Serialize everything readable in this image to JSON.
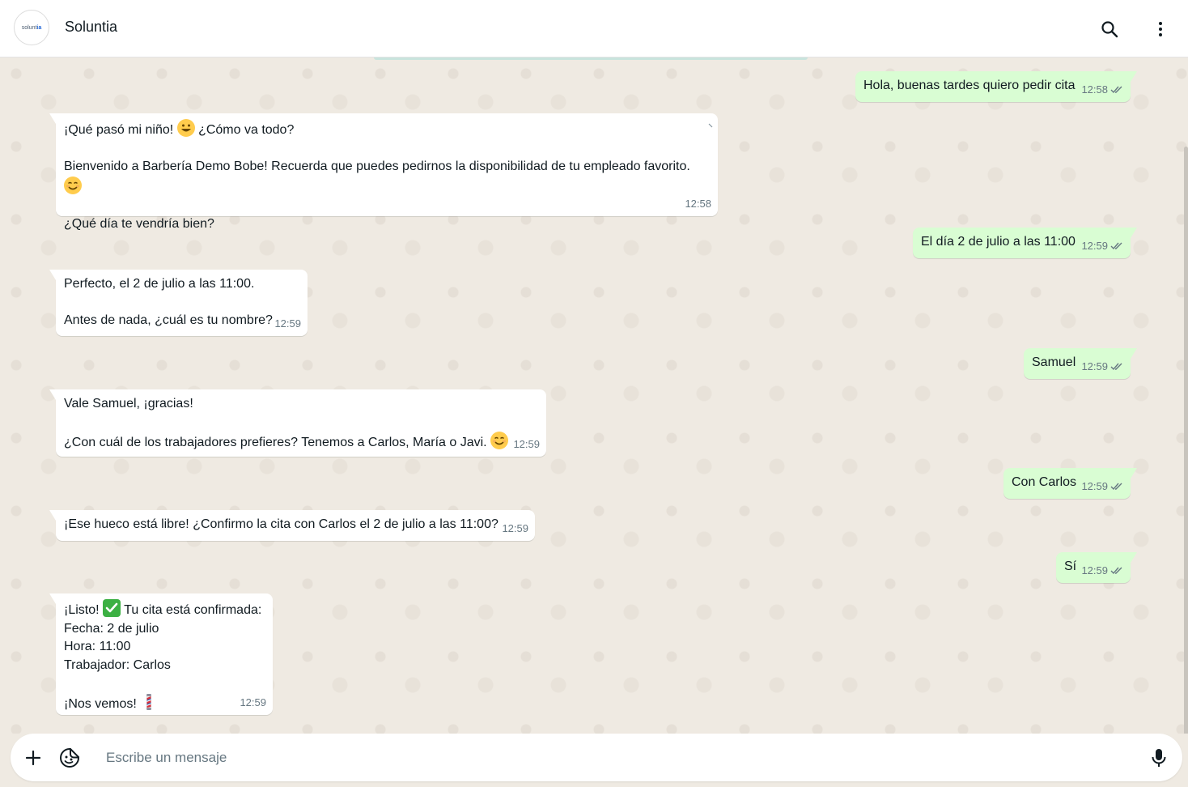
{
  "header": {
    "avatar_text_prefix": "solunt",
    "avatar_text_accent": "ia",
    "contact_name": "Soluntia"
  },
  "messages": [
    {
      "dir": "out",
      "text": "Hola, buenas tardes quiero pedir cita",
      "time": "12:58"
    },
    {
      "dir": "in",
      "line1": "¡Qué pasó mi niño! ",
      "line1b": " ¿Cómo va todo?",
      "line2": "Bienvenido a Barbería Demo Bobe! Recuerda que puedes pedirnos la disponibilidad de tu empleado favorito. ",
      "line3": "¿Qué día te vendría bien?",
      "time": "12:58"
    },
    {
      "dir": "out",
      "text": "El día 2 de julio a las 11:00",
      "time": "12:59"
    },
    {
      "dir": "in",
      "line1": "Perfecto, el 2 de julio a las 11:00.",
      "line2": "Antes de nada, ¿cuál es tu nombre?",
      "time": "12:59"
    },
    {
      "dir": "out",
      "text": "Samuel",
      "time": "12:59"
    },
    {
      "dir": "in",
      "line1": "Vale Samuel, ¡gracias!",
      "line2": "¿Con cuál de los trabajadores prefieres? Tenemos a Carlos, María o Javi. ",
      "time": "12:59"
    },
    {
      "dir": "out",
      "text": "Con Carlos",
      "time": "12:59"
    },
    {
      "dir": "in",
      "line1": "¡Ese hueco está libre! ¿Confirmo la cita con Carlos el 2 de julio a las 11:00?",
      "time": "12:59"
    },
    {
      "dir": "out",
      "text": "Sí",
      "time": "12:59"
    },
    {
      "dir": "in",
      "line1": "¡Listo! ",
      "line1b": " Tu cita está confirmada:",
      "line2": "Fecha: 2 de julio",
      "line3": "Hora: 11:00",
      "line4": "Trabajador: Carlos",
      "line5": "¡Nos vemos! ",
      "time": "12:59"
    }
  ],
  "composer": {
    "placeholder": "Escribe un mensaje"
  },
  "icons": {
    "search": "search-icon",
    "menu": "more-vertical-icon",
    "attach": "plus-icon",
    "sticker": "sticker-icon",
    "mic": "microphone-icon",
    "read": "double-check-icon"
  },
  "colors": {
    "outgoing_bubble": "#d9fdd3",
    "incoming_bubble": "#ffffff",
    "chat_background": "#efeae2",
    "meta_text": "#667781"
  }
}
